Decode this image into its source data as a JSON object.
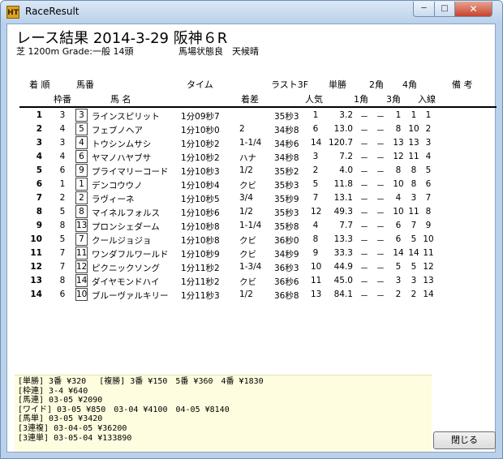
{
  "window": {
    "title": "RaceResult",
    "icon_label": "HT",
    "controls": {
      "minimize": "─",
      "maximize": "□",
      "close": "✕"
    }
  },
  "heading": "レース結果 2014-3-29 阪神６R",
  "subinfo": {
    "course": "芝 1200m Grade:一般 14頭",
    "conditions": "馬場状態良　天候晴"
  },
  "headers": {
    "top": {
      "chakujun": "着 順",
      "umaban": "馬番",
      "time": "タイム",
      "last3f": "ラスト3F",
      "tansho": "単勝",
      "kaku2": "2角",
      "kaku4": "4角",
      "biko": "備 考"
    },
    "bottom": {
      "wakuban": "枠番",
      "horse_name": "馬 名",
      "chakusa": "着差",
      "ninki": "人気",
      "kaku1": "1角",
      "kaku3": "3角",
      "nyusen": "入線"
    }
  },
  "rows": [
    {
      "ord": "1",
      "waku": "3",
      "uma": "3",
      "name": "ラインスピリット",
      "time": "1分09秒7",
      "margin": "",
      "l3f": "35秒3",
      "pop": "1",
      "odds": "3.2",
      "c1": "－",
      "c2": "－",
      "c3": "1",
      "c4": "1",
      "line": "1"
    },
    {
      "ord": "2",
      "waku": "4",
      "uma": "5",
      "name": "フェブノヘア",
      "time": "1分10秒0",
      "margin": "2",
      "l3f": "34秒8",
      "pop": "6",
      "odds": "13.0",
      "c1": "－",
      "c2": "－",
      "c3": "8",
      "c4": "10",
      "line": "2"
    },
    {
      "ord": "3",
      "waku": "3",
      "uma": "4",
      "name": "トウシンムサシ",
      "time": "1分10秒2",
      "margin": "1-1/4",
      "l3f": "34秒6",
      "pop": "14",
      "odds": "120.7",
      "c1": "－",
      "c2": "－",
      "c3": "13",
      "c4": "13",
      "line": "3"
    },
    {
      "ord": "4",
      "waku": "4",
      "uma": "6",
      "name": "ヤマノハヤブサ",
      "time": "1分10秒2",
      "margin": "ハナ",
      "l3f": "34秒8",
      "pop": "3",
      "odds": "7.2",
      "c1": "－",
      "c2": "－",
      "c3": "12",
      "c4": "11",
      "line": "4"
    },
    {
      "ord": "5",
      "waku": "6",
      "uma": "9",
      "name": "プライマリーコード",
      "time": "1分10秒3",
      "margin": "1/2",
      "l3f": "35秒2",
      "pop": "2",
      "odds": "4.0",
      "c1": "－",
      "c2": "－",
      "c3": "8",
      "c4": "8",
      "line": "5"
    },
    {
      "ord": "6",
      "waku": "1",
      "uma": "1",
      "name": "デンコウウノ",
      "time": "1分10秒4",
      "margin": "クビ",
      "l3f": "35秒3",
      "pop": "5",
      "odds": "11.8",
      "c1": "－",
      "c2": "－",
      "c3": "10",
      "c4": "8",
      "line": "6"
    },
    {
      "ord": "7",
      "waku": "2",
      "uma": "2",
      "name": "ラヴィーネ",
      "time": "1分10秒5",
      "margin": "3/4",
      "l3f": "35秒9",
      "pop": "7",
      "odds": "13.1",
      "c1": "－",
      "c2": "－",
      "c3": "4",
      "c4": "3",
      "line": "7"
    },
    {
      "ord": "8",
      "waku": "5",
      "uma": "8",
      "name": "マイネルフォルス",
      "time": "1分10秒6",
      "margin": "1/2",
      "l3f": "35秒3",
      "pop": "12",
      "odds": "49.3",
      "c1": "－",
      "c2": "－",
      "c3": "10",
      "c4": "11",
      "line": "8"
    },
    {
      "ord": "9",
      "waku": "8",
      "uma": "13",
      "name": "プロンシェダーム",
      "time": "1分10秒8",
      "margin": "1-1/4",
      "l3f": "35秒8",
      "pop": "4",
      "odds": "7.7",
      "c1": "－",
      "c2": "－",
      "c3": "6",
      "c4": "7",
      "line": "9"
    },
    {
      "ord": "10",
      "waku": "5",
      "uma": "7",
      "name": "クールジョジョ",
      "time": "1分10秒8",
      "margin": "クビ",
      "l3f": "36秒0",
      "pop": "8",
      "odds": "13.3",
      "c1": "－",
      "c2": "－",
      "c3": "6",
      "c4": "5",
      "line": "10"
    },
    {
      "ord": "11",
      "waku": "7",
      "uma": "11",
      "name": "ワンダフルワールド",
      "time": "1分10秒9",
      "margin": "クビ",
      "l3f": "34秒9",
      "pop": "9",
      "odds": "33.3",
      "c1": "－",
      "c2": "－",
      "c3": "14",
      "c4": "14",
      "line": "11"
    },
    {
      "ord": "12",
      "waku": "7",
      "uma": "12",
      "name": "ピクニックソング",
      "time": "1分11秒2",
      "margin": "1-3/4",
      "l3f": "36秒3",
      "pop": "10",
      "odds": "44.9",
      "c1": "－",
      "c2": "－",
      "c3": "5",
      "c4": "5",
      "line": "12"
    },
    {
      "ord": "13",
      "waku": "8",
      "uma": "14",
      "name": "ダイヤモンドハイ",
      "time": "1分11秒2",
      "margin": "クビ",
      "l3f": "36秒6",
      "pop": "11",
      "odds": "45.0",
      "c1": "－",
      "c2": "－",
      "c3": "3",
      "c4": "3",
      "line": "13"
    },
    {
      "ord": "14",
      "waku": "6",
      "uma": "10",
      "name": "ブルーヴァルキリー",
      "time": "1分11秒3",
      "margin": "1/2",
      "l3f": "36秒8",
      "pop": "13",
      "odds": "84.1",
      "c1": "－",
      "c2": "－",
      "c3": "2",
      "c4": "2",
      "line": "14"
    }
  ],
  "payouts": [
    "[単勝] 3番 ¥320　 [複勝] 3番 ¥150　5番 ¥360　4番 ¥1830",
    "[枠連] 3-4 ¥640",
    "[馬連] 03-05 ¥2090",
    "[ワイド] 03-05 ¥850　03-04 ¥4100　04-05 ¥8140",
    "[馬単] 03-05 ¥3420",
    "[3連複] 03-04-05 ¥36200",
    "[3連単] 03-05-04 ¥133890"
  ],
  "close_button_label": "閉じる"
}
